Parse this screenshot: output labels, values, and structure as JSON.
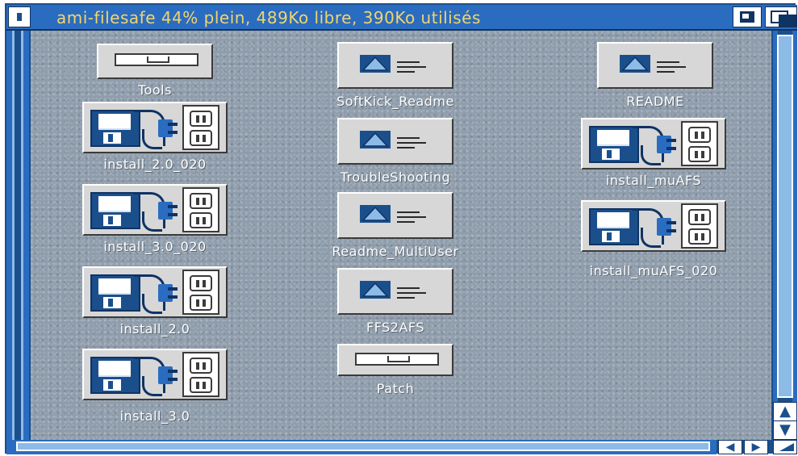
{
  "window": {
    "title": "ami-filesafe  44% plein, 489Ko libre, 390Ko utilisés"
  },
  "icons": {
    "tools": "Tools",
    "softkick_readme": "SoftKick_Readme",
    "readme": "README",
    "install_2_0_020": "install_2.0_020",
    "troubleshooting": "TroubleShooting",
    "install_muafs": "install_muAFS",
    "install_3_0_020": "install_3.0_020",
    "readme_multiuser": "Readme_MultiUser",
    "install_muafs_020": "install_muAFS_020",
    "install_2_0": "install_2.0",
    "ffs2afs": "FFS2AFS",
    "install_3_0": "install_3.0",
    "patch": "Patch"
  },
  "colors": {
    "title_text": "#f2d56b",
    "window_blue": "#2a6cc0",
    "backdrop_grey": "#8e9cab"
  }
}
